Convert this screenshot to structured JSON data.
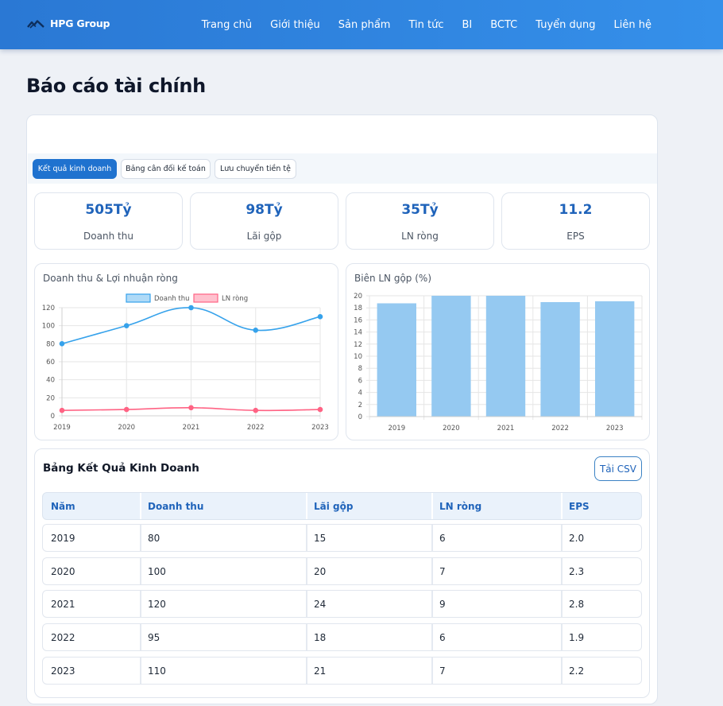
{
  "navbar": {
    "brand": "HPG Group",
    "links": [
      "Trang chủ",
      "Giới thiệu",
      "Sản phẩm",
      "Tin tức",
      "BI",
      "BCTC",
      "Tuyển dụng",
      "Liên hệ"
    ]
  },
  "page": {
    "title": "Báo cáo tài chính"
  },
  "tabs": [
    "Kết quả kinh doanh",
    "Bảng cân đối kế toán",
    "Lưu chuyển tiền tệ"
  ],
  "active_tab": 0,
  "kpis": [
    {
      "value": "505Tỷ",
      "label": "Doanh thu"
    },
    {
      "value": "98Tỷ",
      "label": "Lãi gộp"
    },
    {
      "value": "35Tỷ",
      "label": "LN ròng"
    },
    {
      "value": "11.2",
      "label": "EPS"
    }
  ],
  "chart_data": [
    {
      "type": "line",
      "title": "Doanh thu & Lợi nhuận ròng",
      "x": [
        "2019",
        "2020",
        "2021",
        "2022",
        "2023"
      ],
      "series": [
        {
          "name": "Doanh thu",
          "values": [
            80,
            100,
            120,
            95,
            110
          ],
          "color": "#36a2eb"
        },
        {
          "name": "LN ròng",
          "values": [
            6,
            7,
            9,
            6,
            7
          ],
          "color": "#ff6384"
        }
      ],
      "ylim": [
        0,
        120
      ],
      "yticks": [
        0,
        20,
        40,
        60,
        80,
        100,
        120
      ],
      "grid": true,
      "legend": "top"
    },
    {
      "type": "bar",
      "title": "Biên LN gộp (%)",
      "categories": [
        "2019",
        "2020",
        "2021",
        "2022",
        "2023"
      ],
      "values": [
        18.75,
        20,
        20,
        18.95,
        19.09
      ],
      "color": "#95c9f1",
      "ylim": [
        0,
        20
      ],
      "yticks": [
        0,
        2,
        4,
        6,
        8,
        10,
        12,
        14,
        16,
        18,
        20
      ],
      "grid": true
    }
  ],
  "table": {
    "title": "Bảng Kết Quả Kinh Doanh",
    "csv_button": "Tải CSV",
    "columns": [
      "Năm",
      "Doanh thu",
      "Lãi gộp",
      "LN ròng",
      "EPS"
    ],
    "rows": [
      [
        "2019",
        "80",
        "15",
        "6",
        "2.0"
      ],
      [
        "2020",
        "100",
        "20",
        "7",
        "2.3"
      ],
      [
        "2021",
        "120",
        "24",
        "9",
        "2.8"
      ],
      [
        "2022",
        "95",
        "18",
        "6",
        "1.9"
      ],
      [
        "2023",
        "110",
        "21",
        "7",
        "2.2"
      ]
    ]
  }
}
